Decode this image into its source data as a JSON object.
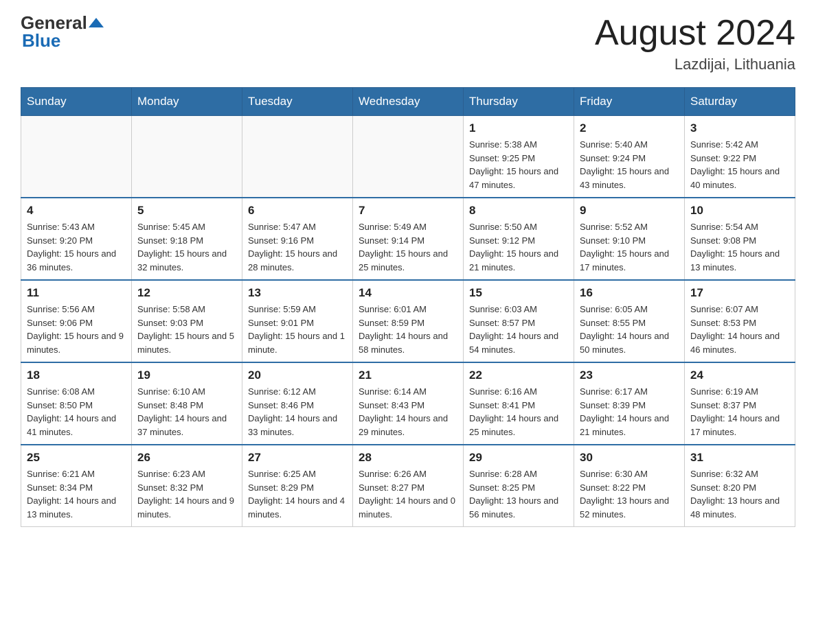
{
  "header": {
    "logo": {
      "general": "General",
      "blue": "Blue"
    },
    "title": "August 2024",
    "location": "Lazdijai, Lithuania"
  },
  "days_of_week": [
    "Sunday",
    "Monday",
    "Tuesday",
    "Wednesday",
    "Thursday",
    "Friday",
    "Saturday"
  ],
  "weeks": [
    [
      {
        "day": "",
        "sunrise": "",
        "sunset": "",
        "daylight": ""
      },
      {
        "day": "",
        "sunrise": "",
        "sunset": "",
        "daylight": ""
      },
      {
        "day": "",
        "sunrise": "",
        "sunset": "",
        "daylight": ""
      },
      {
        "day": "",
        "sunrise": "",
        "sunset": "",
        "daylight": ""
      },
      {
        "day": "1",
        "sunrise": "Sunrise: 5:38 AM",
        "sunset": "Sunset: 9:25 PM",
        "daylight": "Daylight: 15 hours and 47 minutes."
      },
      {
        "day": "2",
        "sunrise": "Sunrise: 5:40 AM",
        "sunset": "Sunset: 9:24 PM",
        "daylight": "Daylight: 15 hours and 43 minutes."
      },
      {
        "day": "3",
        "sunrise": "Sunrise: 5:42 AM",
        "sunset": "Sunset: 9:22 PM",
        "daylight": "Daylight: 15 hours and 40 minutes."
      }
    ],
    [
      {
        "day": "4",
        "sunrise": "Sunrise: 5:43 AM",
        "sunset": "Sunset: 9:20 PM",
        "daylight": "Daylight: 15 hours and 36 minutes."
      },
      {
        "day": "5",
        "sunrise": "Sunrise: 5:45 AM",
        "sunset": "Sunset: 9:18 PM",
        "daylight": "Daylight: 15 hours and 32 minutes."
      },
      {
        "day": "6",
        "sunrise": "Sunrise: 5:47 AM",
        "sunset": "Sunset: 9:16 PM",
        "daylight": "Daylight: 15 hours and 28 minutes."
      },
      {
        "day": "7",
        "sunrise": "Sunrise: 5:49 AM",
        "sunset": "Sunset: 9:14 PM",
        "daylight": "Daylight: 15 hours and 25 minutes."
      },
      {
        "day": "8",
        "sunrise": "Sunrise: 5:50 AM",
        "sunset": "Sunset: 9:12 PM",
        "daylight": "Daylight: 15 hours and 21 minutes."
      },
      {
        "day": "9",
        "sunrise": "Sunrise: 5:52 AM",
        "sunset": "Sunset: 9:10 PM",
        "daylight": "Daylight: 15 hours and 17 minutes."
      },
      {
        "day": "10",
        "sunrise": "Sunrise: 5:54 AM",
        "sunset": "Sunset: 9:08 PM",
        "daylight": "Daylight: 15 hours and 13 minutes."
      }
    ],
    [
      {
        "day": "11",
        "sunrise": "Sunrise: 5:56 AM",
        "sunset": "Sunset: 9:06 PM",
        "daylight": "Daylight: 15 hours and 9 minutes."
      },
      {
        "day": "12",
        "sunrise": "Sunrise: 5:58 AM",
        "sunset": "Sunset: 9:03 PM",
        "daylight": "Daylight: 15 hours and 5 minutes."
      },
      {
        "day": "13",
        "sunrise": "Sunrise: 5:59 AM",
        "sunset": "Sunset: 9:01 PM",
        "daylight": "Daylight: 15 hours and 1 minute."
      },
      {
        "day": "14",
        "sunrise": "Sunrise: 6:01 AM",
        "sunset": "Sunset: 8:59 PM",
        "daylight": "Daylight: 14 hours and 58 minutes."
      },
      {
        "day": "15",
        "sunrise": "Sunrise: 6:03 AM",
        "sunset": "Sunset: 8:57 PM",
        "daylight": "Daylight: 14 hours and 54 minutes."
      },
      {
        "day": "16",
        "sunrise": "Sunrise: 6:05 AM",
        "sunset": "Sunset: 8:55 PM",
        "daylight": "Daylight: 14 hours and 50 minutes."
      },
      {
        "day": "17",
        "sunrise": "Sunrise: 6:07 AM",
        "sunset": "Sunset: 8:53 PM",
        "daylight": "Daylight: 14 hours and 46 minutes."
      }
    ],
    [
      {
        "day": "18",
        "sunrise": "Sunrise: 6:08 AM",
        "sunset": "Sunset: 8:50 PM",
        "daylight": "Daylight: 14 hours and 41 minutes."
      },
      {
        "day": "19",
        "sunrise": "Sunrise: 6:10 AM",
        "sunset": "Sunset: 8:48 PM",
        "daylight": "Daylight: 14 hours and 37 minutes."
      },
      {
        "day": "20",
        "sunrise": "Sunrise: 6:12 AM",
        "sunset": "Sunset: 8:46 PM",
        "daylight": "Daylight: 14 hours and 33 minutes."
      },
      {
        "day": "21",
        "sunrise": "Sunrise: 6:14 AM",
        "sunset": "Sunset: 8:43 PM",
        "daylight": "Daylight: 14 hours and 29 minutes."
      },
      {
        "day": "22",
        "sunrise": "Sunrise: 6:16 AM",
        "sunset": "Sunset: 8:41 PM",
        "daylight": "Daylight: 14 hours and 25 minutes."
      },
      {
        "day": "23",
        "sunrise": "Sunrise: 6:17 AM",
        "sunset": "Sunset: 8:39 PM",
        "daylight": "Daylight: 14 hours and 21 minutes."
      },
      {
        "day": "24",
        "sunrise": "Sunrise: 6:19 AM",
        "sunset": "Sunset: 8:37 PM",
        "daylight": "Daylight: 14 hours and 17 minutes."
      }
    ],
    [
      {
        "day": "25",
        "sunrise": "Sunrise: 6:21 AM",
        "sunset": "Sunset: 8:34 PM",
        "daylight": "Daylight: 14 hours and 13 minutes."
      },
      {
        "day": "26",
        "sunrise": "Sunrise: 6:23 AM",
        "sunset": "Sunset: 8:32 PM",
        "daylight": "Daylight: 14 hours and 9 minutes."
      },
      {
        "day": "27",
        "sunrise": "Sunrise: 6:25 AM",
        "sunset": "Sunset: 8:29 PM",
        "daylight": "Daylight: 14 hours and 4 minutes."
      },
      {
        "day": "28",
        "sunrise": "Sunrise: 6:26 AM",
        "sunset": "Sunset: 8:27 PM",
        "daylight": "Daylight: 14 hours and 0 minutes."
      },
      {
        "day": "29",
        "sunrise": "Sunrise: 6:28 AM",
        "sunset": "Sunset: 8:25 PM",
        "daylight": "Daylight: 13 hours and 56 minutes."
      },
      {
        "day": "30",
        "sunrise": "Sunrise: 6:30 AM",
        "sunset": "Sunset: 8:22 PM",
        "daylight": "Daylight: 13 hours and 52 minutes."
      },
      {
        "day": "31",
        "sunrise": "Sunrise: 6:32 AM",
        "sunset": "Sunset: 8:20 PM",
        "daylight": "Daylight: 13 hours and 48 minutes."
      }
    ]
  ]
}
